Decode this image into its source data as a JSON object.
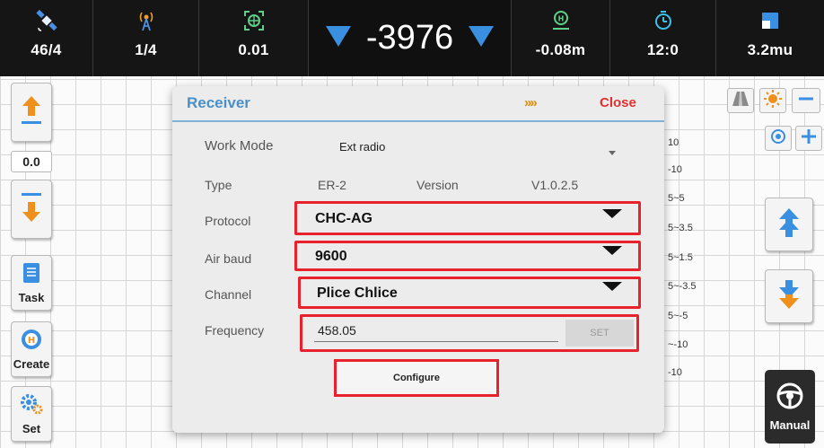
{
  "status_bar": {
    "satellites": {
      "icon": "satellite-icon",
      "value": "46/4"
    },
    "radio": {
      "icon": "radio-signal-icon",
      "value": "1/4"
    },
    "precision": {
      "icon": "gps-target-icon",
      "value": "0.01"
    },
    "deviation": {
      "value": "-3976"
    },
    "offset": {
      "icon": "offset-marker-icon",
      "value": "-0.08m"
    },
    "time": {
      "icon": "timer-icon",
      "value": "12:0"
    },
    "area": {
      "icon": "area-icon",
      "value": "3.2mu"
    }
  },
  "left_toolbar": {
    "offset_value": "0.0",
    "task_label": "Task",
    "create_label": "Create",
    "set_label": "Set"
  },
  "right_toolbar": {
    "manual_label": "Manual"
  },
  "map_labels": [
    "10",
    "-10",
    "5~5",
    "5~3.5",
    "5~1.5",
    "5~-3.5",
    "5~-5",
    "~-10",
    "-10"
  ],
  "dialog": {
    "title": "Receiver",
    "more_icon": "»»",
    "close_label": "Close",
    "work_mode": {
      "label": "Work Mode",
      "value": "Ext radio"
    },
    "type": {
      "label": "Type",
      "value": "ER-2"
    },
    "version": {
      "label": "Version",
      "value": "V1.0.2.5"
    },
    "protocol": {
      "label": "Protocol",
      "value": "CHC-AG"
    },
    "air_baud": {
      "label": "Air baud",
      "value": "9600"
    },
    "channel": {
      "label": "Channel",
      "value": "Plice Chlice"
    },
    "frequency": {
      "label": "Frequency",
      "value": "458.05",
      "set_label": "SET"
    },
    "configure_label": "Configure"
  },
  "colors": {
    "accent_blue": "#4a8fc8",
    "close_red": "#e03030",
    "highlight_red": "#e8222c",
    "arrow_orange": "#e08a00",
    "triangle_blue": "#3a8fe0"
  }
}
